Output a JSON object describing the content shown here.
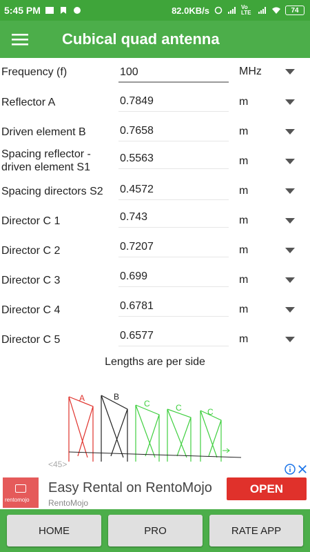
{
  "status": {
    "time": "5:45 PM",
    "network_speed": "82.0KB/s",
    "lte": "Vo LTE",
    "battery": "74"
  },
  "app": {
    "title": "Cubical quad antenna"
  },
  "rows": [
    {
      "label": "Frequency (f)",
      "value": "100",
      "unit": "MHz"
    },
    {
      "label": "Reflector A",
      "value": "0.7849",
      "unit": "m"
    },
    {
      "label": "Driven element B",
      "value": "0.7658",
      "unit": "m"
    },
    {
      "label": "Spacing reflector - driven element S1",
      "value": "0.5563",
      "unit": "m"
    },
    {
      "label": "Spacing directors S2",
      "value": "0.4572",
      "unit": "m"
    },
    {
      "label": "Director C 1",
      "value": "0.743",
      "unit": "m"
    },
    {
      "label": "Director C 2",
      "value": "0.7207",
      "unit": "m"
    },
    {
      "label": "Director C 3",
      "value": "0.699",
      "unit": "m"
    },
    {
      "label": "Director C 4",
      "value": "0.6781",
      "unit": "m"
    },
    {
      "label": "Director C 5",
      "value": "0.6577",
      "unit": "m"
    }
  ],
  "note": "Lengths are per side",
  "diagram": {
    "labels": [
      "A",
      "B",
      "C",
      "C",
      "C"
    ]
  },
  "ad": {
    "top_text": "<45>",
    "logo_text": "rentomojo",
    "title": "Easy Rental on RentoMojo",
    "subtitle": "RentoMojo",
    "cta": "OPEN"
  },
  "nav": {
    "home": "HOME",
    "pro": "PRO",
    "rate": "RATE APP"
  },
  "colors": {
    "primary": "#4cae4a",
    "status": "#3fa53a",
    "reflector": "#e0312b",
    "driven": "#222222",
    "director": "#3fcf3f"
  }
}
